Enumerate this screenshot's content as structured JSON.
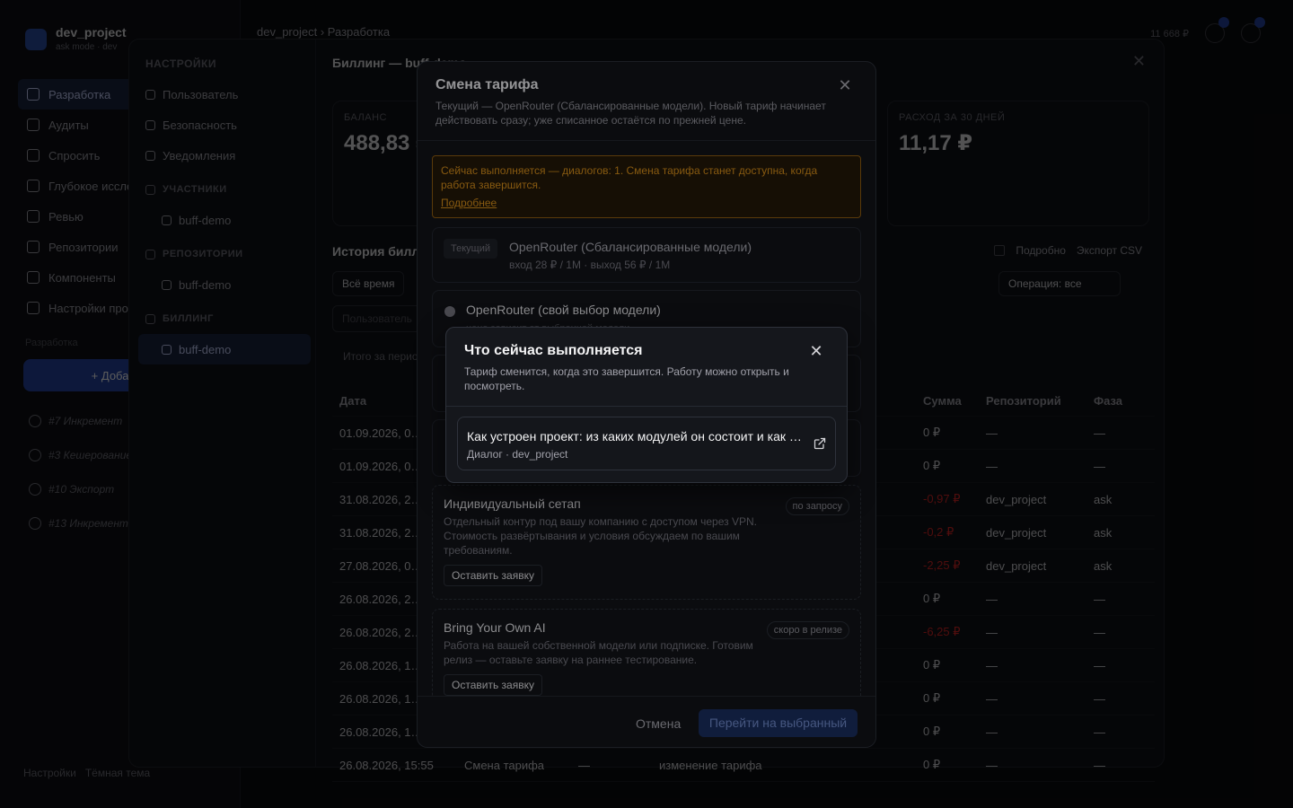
{
  "app": {
    "project_name": "dev_project",
    "project_sub": "ask mode · dev",
    "breadcrumb": "dev_project › Разработка",
    "top_balance": "11 668 ₽",
    "nav": [
      {
        "label": "Разработка",
        "active": true
      },
      {
        "label": "Аудиты"
      },
      {
        "label": "Спросить"
      },
      {
        "label": "Глубокое исследование"
      },
      {
        "label": "Ревью"
      },
      {
        "label": "Репозитории"
      },
      {
        "label": "Компоненты"
      },
      {
        "label": "Настройки проекта"
      }
    ],
    "section_label": "Разработка",
    "add_button": "+ Добавить",
    "chats": [
      "#7 Инкремент",
      "#3 Кешерование",
      "#10 Экспорт",
      "#13 Инкремент"
    ],
    "footer_settings": "Настройки",
    "footer_theme": "Tёмная тема"
  },
  "settings": {
    "title": "НАСТРОЙКИ",
    "items": [
      {
        "label": "Пользователь",
        "type": "item"
      },
      {
        "label": "Безопасность",
        "type": "item"
      },
      {
        "label": "Уведомления",
        "type": "item"
      },
      {
        "label": "УЧАСТНИКИ",
        "type": "head"
      },
      {
        "label": "buff-demo",
        "type": "sub"
      },
      {
        "label": "РЕПОЗИТОРИИ",
        "type": "head"
      },
      {
        "label": "buff-demo",
        "type": "sub"
      },
      {
        "label": "БИЛЛИНГ",
        "type": "head"
      },
      {
        "label": "buff-demo",
        "type": "sub",
        "active": true
      }
    ],
    "billing_title": "Биллинг — buff-demo",
    "balance_label": "БАЛАНС",
    "balance_value": "488,83 ₽",
    "expense_label": "РАСХОД ЗА 30 ДНЕЙ",
    "expense_value": "11,17 ₽",
    "history_title": "История биллинга",
    "detail_label": "Подробно",
    "export_label": "Экспорт CSV",
    "filter_period": "Всё время",
    "filter_operation": "Операция: все",
    "search_placeholder": "Пользователь",
    "total_label": "Итого за период",
    "columns": [
      "Дата",
      "Операция",
      "",
      "Описание",
      "Сумма",
      "Репозиторий",
      "Фаза"
    ],
    "rows": [
      {
        "date": "01.09.2026, 0…",
        "op": "",
        "dash": "",
        "desc": "",
        "sum": "0 ₽",
        "repo": "—",
        "phase": "—",
        "neg": false
      },
      {
        "date": "01.09.2026, 0…",
        "op": "",
        "dash": "",
        "desc": "",
        "sum": "0 ₽",
        "repo": "—",
        "phase": "—",
        "neg": false
      },
      {
        "date": "31.08.2026, 2…",
        "op": "",
        "dash": "",
        "desc": "",
        "sum": "-0,97 ₽",
        "repo": "dev_project",
        "phase": "ask",
        "neg": true
      },
      {
        "date": "31.08.2026, 2…",
        "op": "",
        "dash": "",
        "desc": "",
        "sum": "-0,2 ₽",
        "repo": "dev_project",
        "phase": "ask",
        "neg": true
      },
      {
        "date": "27.08.2026, 0…",
        "op": "",
        "dash": "",
        "desc": "",
        "sum": "-2,25 ₽",
        "repo": "dev_project",
        "phase": "ask",
        "neg": true
      },
      {
        "date": "26.08.2026, 2…",
        "op": "",
        "dash": "",
        "desc": "",
        "sum": "0 ₽",
        "repo": "—",
        "phase": "—",
        "neg": false
      },
      {
        "date": "26.08.2026, 2…",
        "op": "",
        "dash": "",
        "desc": "",
        "sum": "-6,25 ₽",
        "repo": "—",
        "phase": "—",
        "neg": true
      },
      {
        "date": "26.08.2026, 1…",
        "op": "",
        "dash": "",
        "desc": "",
        "sum": "0 ₽",
        "repo": "—",
        "phase": "—",
        "neg": false
      },
      {
        "date": "26.08.2026, 1…",
        "op": "",
        "dash": "",
        "desc": "",
        "sum": "0 ₽",
        "repo": "—",
        "phase": "—",
        "neg": false
      },
      {
        "date": "26.08.2026, 1…",
        "op": "",
        "dash": "",
        "desc": "",
        "sum": "0 ₽",
        "repo": "—",
        "phase": "—",
        "neg": false
      },
      {
        "date": "26.08.2026, 15:55",
        "op": "Смена тарифа",
        "dash": "—",
        "desc": "изменение тарифа",
        "sum": "0 ₽",
        "repo": "—",
        "phase": "—",
        "neg": false
      }
    ]
  },
  "tariff_modal": {
    "title": "Смена тарифа",
    "description": "Текущий — OpenRouter (Сбалансированные модели). Новый тариф начинает действовать сразу; уже списанное остаётся по прежней цене.",
    "warning_text": "Сейчас выполняется — диалогов: 1. Смена тарифа станет доступна, когда работа завершится.",
    "warning_link": "Подробнее",
    "current_badge": "Текущий",
    "current_plan_name": "OpenRouter (Сбалансированные модели)",
    "current_plan_price": "вход 28 ₽ / 1M · выход 56 ₽ / 1M",
    "plan2_name": "OpenRouter (свой выбор модели)",
    "plan2_sub": "цена зависит от выбранной модели",
    "custom_name": "Индивидуальный сетап",
    "custom_badge": "по запросу",
    "custom_desc": "Отдельный контур под вашу компанию с доступом через VPN. Стоимость развёртывания и условия обсуждаем по вашим требованиям.",
    "custom_button": "Оставить заявку",
    "byo_name": "Bring Your Own AI",
    "byo_badge": "скоро в релизе",
    "byo_desc": "Работа на вашей собственной модели или подписке. Готовим релиз — оставьте заявку на раннее тестирование.",
    "byo_button": "Оставить заявку",
    "cancel_button": "Отмена",
    "apply_button": "Перейти на выбранный"
  },
  "running_dialog": {
    "title": "Что сейчас выполняется",
    "description": "Тариф сменится, когда это завершится. Работу можно открыть и посмотреть.",
    "item_title": "Как устроен проект: из каких модулей он состоит и как они связаны",
    "item_sub": "Диалог · dev_project"
  }
}
